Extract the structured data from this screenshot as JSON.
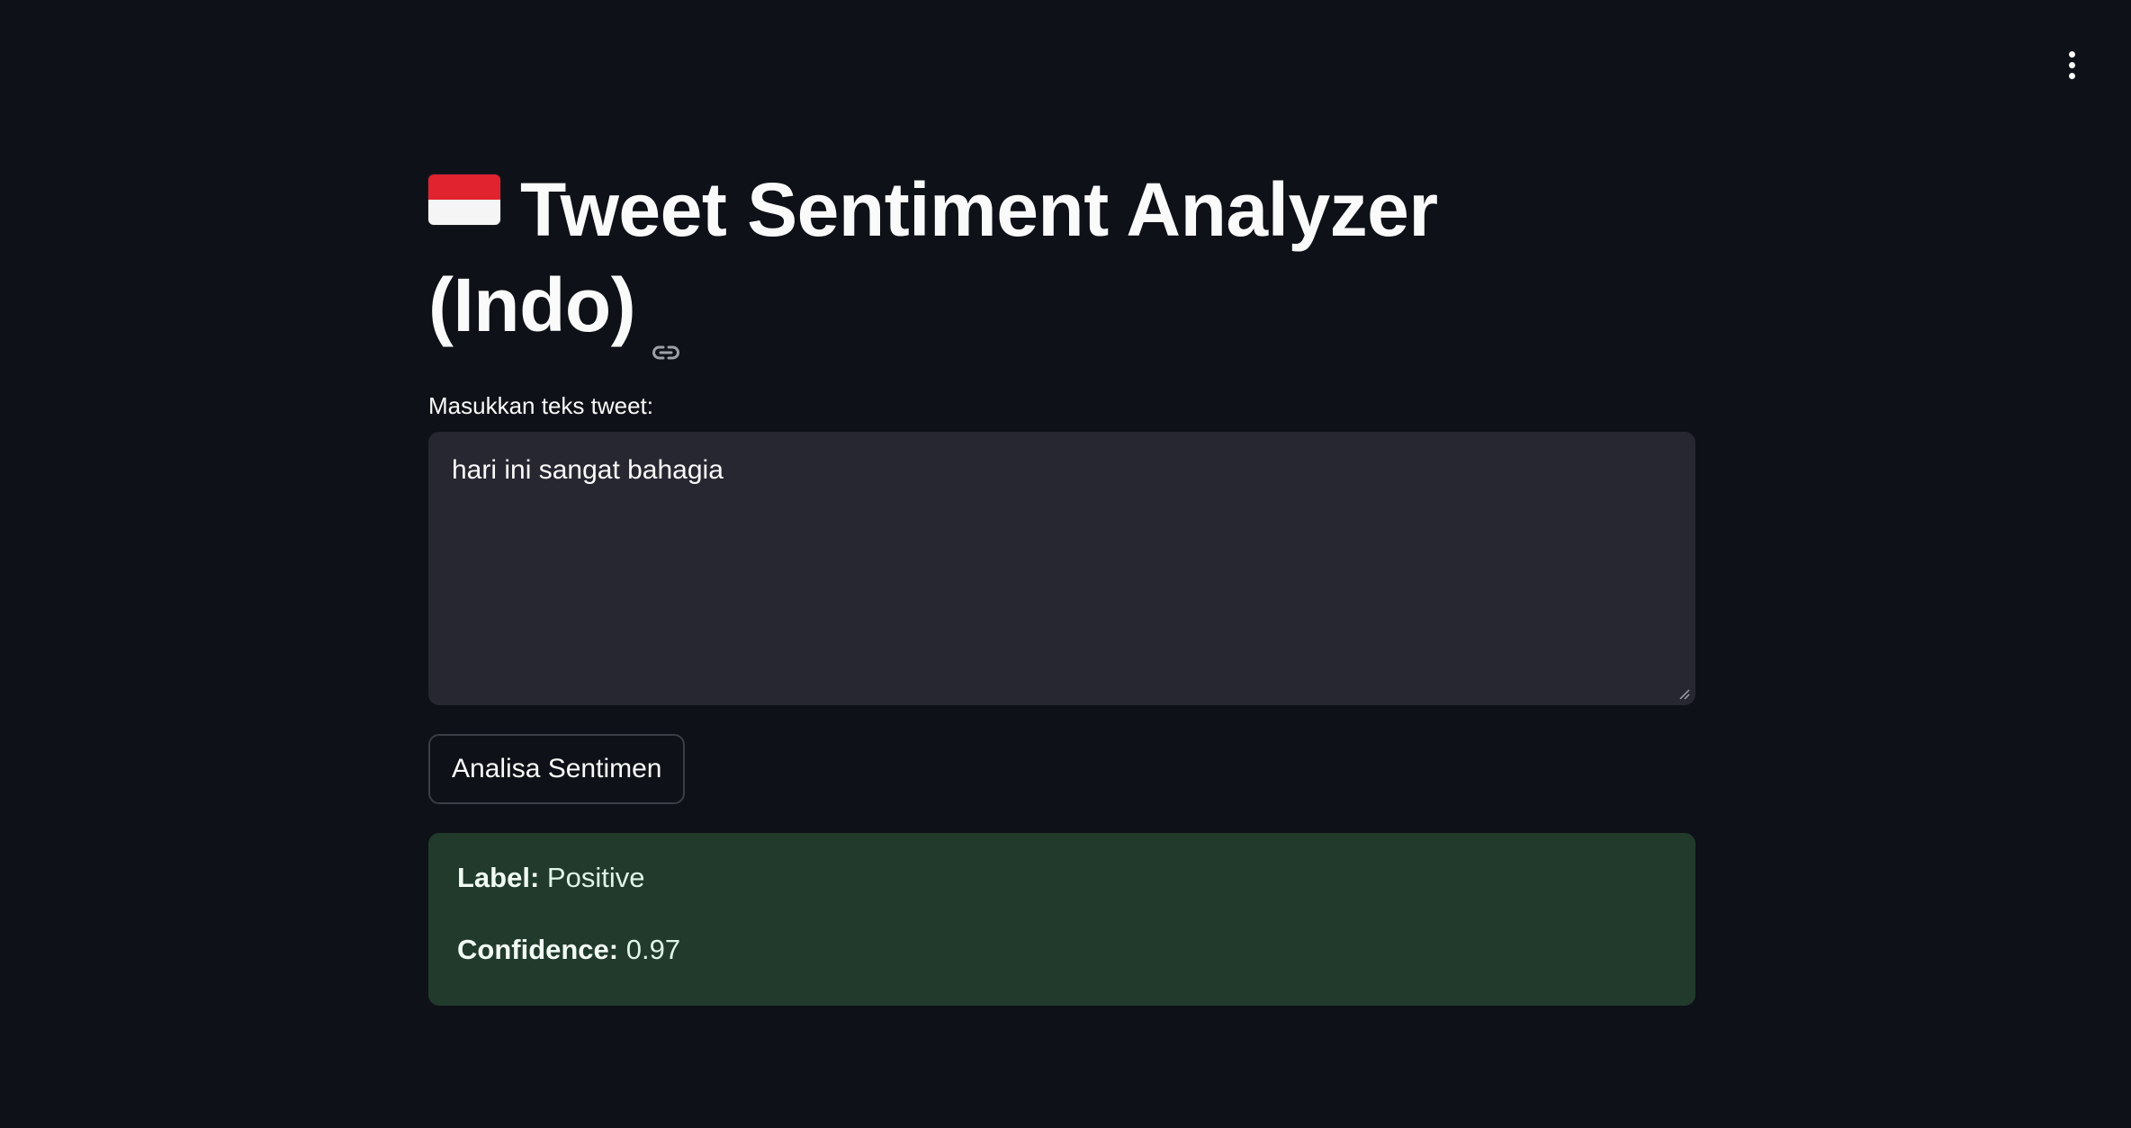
{
  "header": {
    "menu_icon": "kebab-vertical-icon"
  },
  "main": {
    "flag_icon": "indonesia-flag-icon",
    "title": "Tweet Sentiment Analyzer (Indo)",
    "anchor_icon": "link-icon",
    "input": {
      "label": "Masukkan teks tweet:",
      "value": "hari ini sangat bahagia"
    },
    "analyze_button": "Analisa Sentimen",
    "result": {
      "label_key": "Label:",
      "label_value": "Positive",
      "confidence_key": "Confidence:",
      "confidence_value": "0.97"
    }
  },
  "colors": {
    "background": "#0e1117",
    "input_bg": "#262730",
    "success_bg": "#213a2c",
    "flag_red": "#e0232f",
    "flag_white": "#f5f5f5"
  }
}
